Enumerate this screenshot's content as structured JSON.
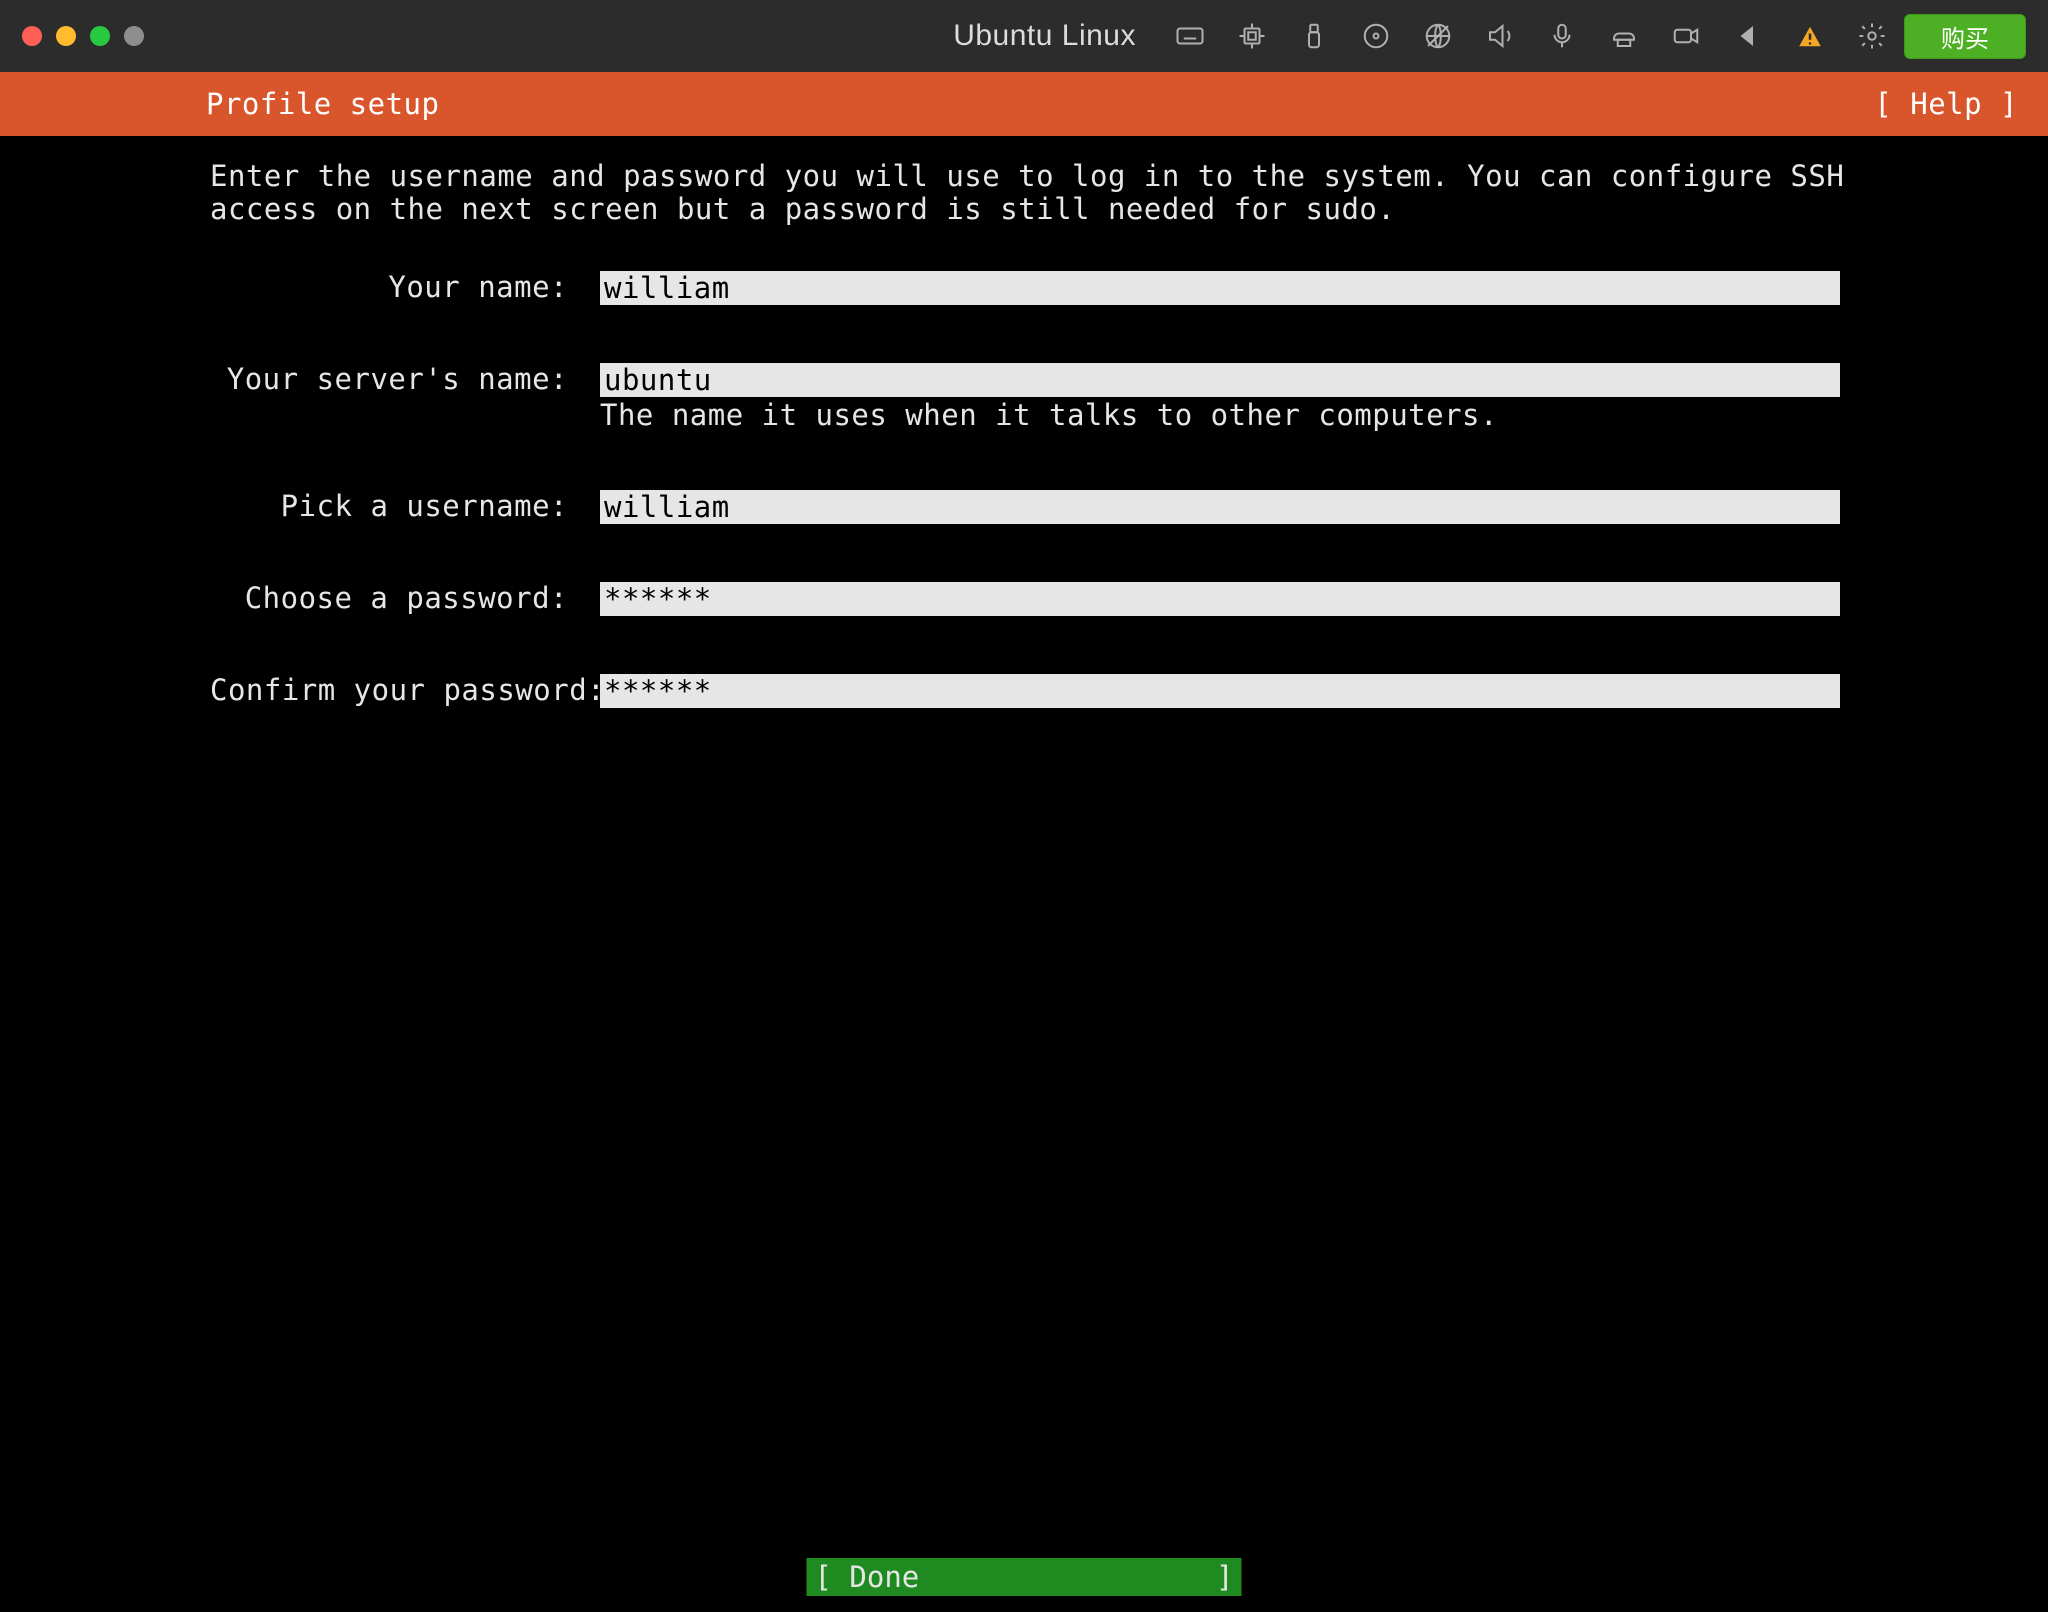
{
  "titlebar": {
    "vm_name": "Ubuntu Linux",
    "buy_label": "购买",
    "icons": [
      "keyboard-icon",
      "cpu-icon",
      "usb-icon",
      "disc-icon",
      "network-icon",
      "sound-icon",
      "microphone-icon",
      "printer-icon",
      "camera-icon",
      "back-icon",
      "warning-icon",
      "settings-icon"
    ]
  },
  "header": {
    "title": "Profile setup",
    "help_label": "[ Help ]"
  },
  "intro_text": "Enter the username and password you will use to log in to the system. You can configure SSH access on the next screen but a password is still needed for sudo.",
  "form": {
    "your_name": {
      "label": "Your name:",
      "value": "william"
    },
    "server_name": {
      "label": "Your server's name:",
      "value": "ubuntu",
      "hint": "The name it uses when it talks to other computers."
    },
    "username": {
      "label": "Pick a username:",
      "value": "william"
    },
    "password": {
      "label": "Choose a password:",
      "value": "******"
    },
    "confirm_password": {
      "label": "Confirm your password:",
      "value": "******"
    }
  },
  "done_button": "[ Done                 ]"
}
